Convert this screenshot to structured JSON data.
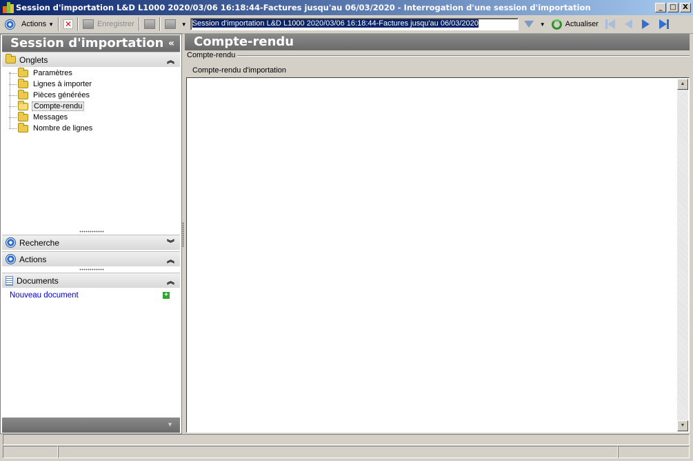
{
  "window": {
    "title": "Session d'importation L&D L1000 2020/03/06 16:18:44-Factures jusqu'au 06/03/2020 -  Interrogation d'une session d'importation",
    "minimize": "_",
    "maximize": "□",
    "close": "X"
  },
  "toolbar": {
    "actions_label": "Actions",
    "save_label": "Enregistrer",
    "search_value": "Session d'importation L&D L1000 2020/03/06 16:18:44-Factures jusqu'au 06/03/2020",
    "refresh_label": "Actualiser"
  },
  "left": {
    "title": "Session d'importation ...",
    "collapse": "«",
    "onglets_label": "Onglets",
    "tree": [
      {
        "label": "Paramètres"
      },
      {
        "label": "Lignes à importer"
      },
      {
        "label": "Pièces générées"
      },
      {
        "label": "Compte-rendu"
      },
      {
        "label": "Messages"
      },
      {
        "label": "Nombre de lignes"
      }
    ],
    "recherche_label": "Recherche",
    "actions_label": "Actions",
    "documents_label": "Documents",
    "new_document": "Nouveau document"
  },
  "right": {
    "title": "Compte-rendu",
    "group_label": "Compte-rendu",
    "report_label": "Compte-rendu d'importation"
  },
  "colors": {
    "title_bar_start": "#0a246a",
    "title_bar_end": "#a6caf0",
    "panel_header": "#7a7a7a",
    "link": "#0000c8"
  }
}
